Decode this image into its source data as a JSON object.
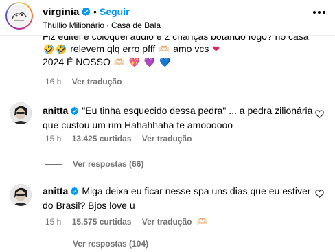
{
  "header": {
    "username": "virginia",
    "follow_label": "Seguir",
    "dot": "•",
    "music_artist": "Thullio Milionário",
    "music_separator": "·",
    "music_song": "Casa de Bala",
    "more_icon": "more-horizontal-icon"
  },
  "top_comment": {
    "clipped_line": "Fiz editei e coloquei áudio e 2 crianças botando fogo? no casa",
    "line2_text": "relevem qlq erro pfff",
    "line2_tail": "amo vcs",
    "line3_text": "2024 É NOSSO",
    "time": "16 h",
    "translate_label": "Ver tradução"
  },
  "comments": [
    {
      "username": "anitta",
      "text": "\"Eu tinha esquecido dessa pedra\" ... a pedra zilionária que custou um rim Hahahhaha te amoooooo",
      "time": "15 h",
      "likes": "13.425 curtidas",
      "translate_label": "Ver tradução",
      "replies_label": "Ver respostas (66)"
    },
    {
      "username": "anitta",
      "text": "Miga deixa eu ficar nesse spa uns dias que eu estiver do Brasil? Bjos love u",
      "time": "15 h",
      "likes": "15.575 curtidas",
      "translate_label": "Ver tradução",
      "replies_label": "Ver respostas (104)"
    }
  ],
  "colors": {
    "verified": "#0095f6",
    "link": "#0095f6",
    "muted": "#737373"
  }
}
